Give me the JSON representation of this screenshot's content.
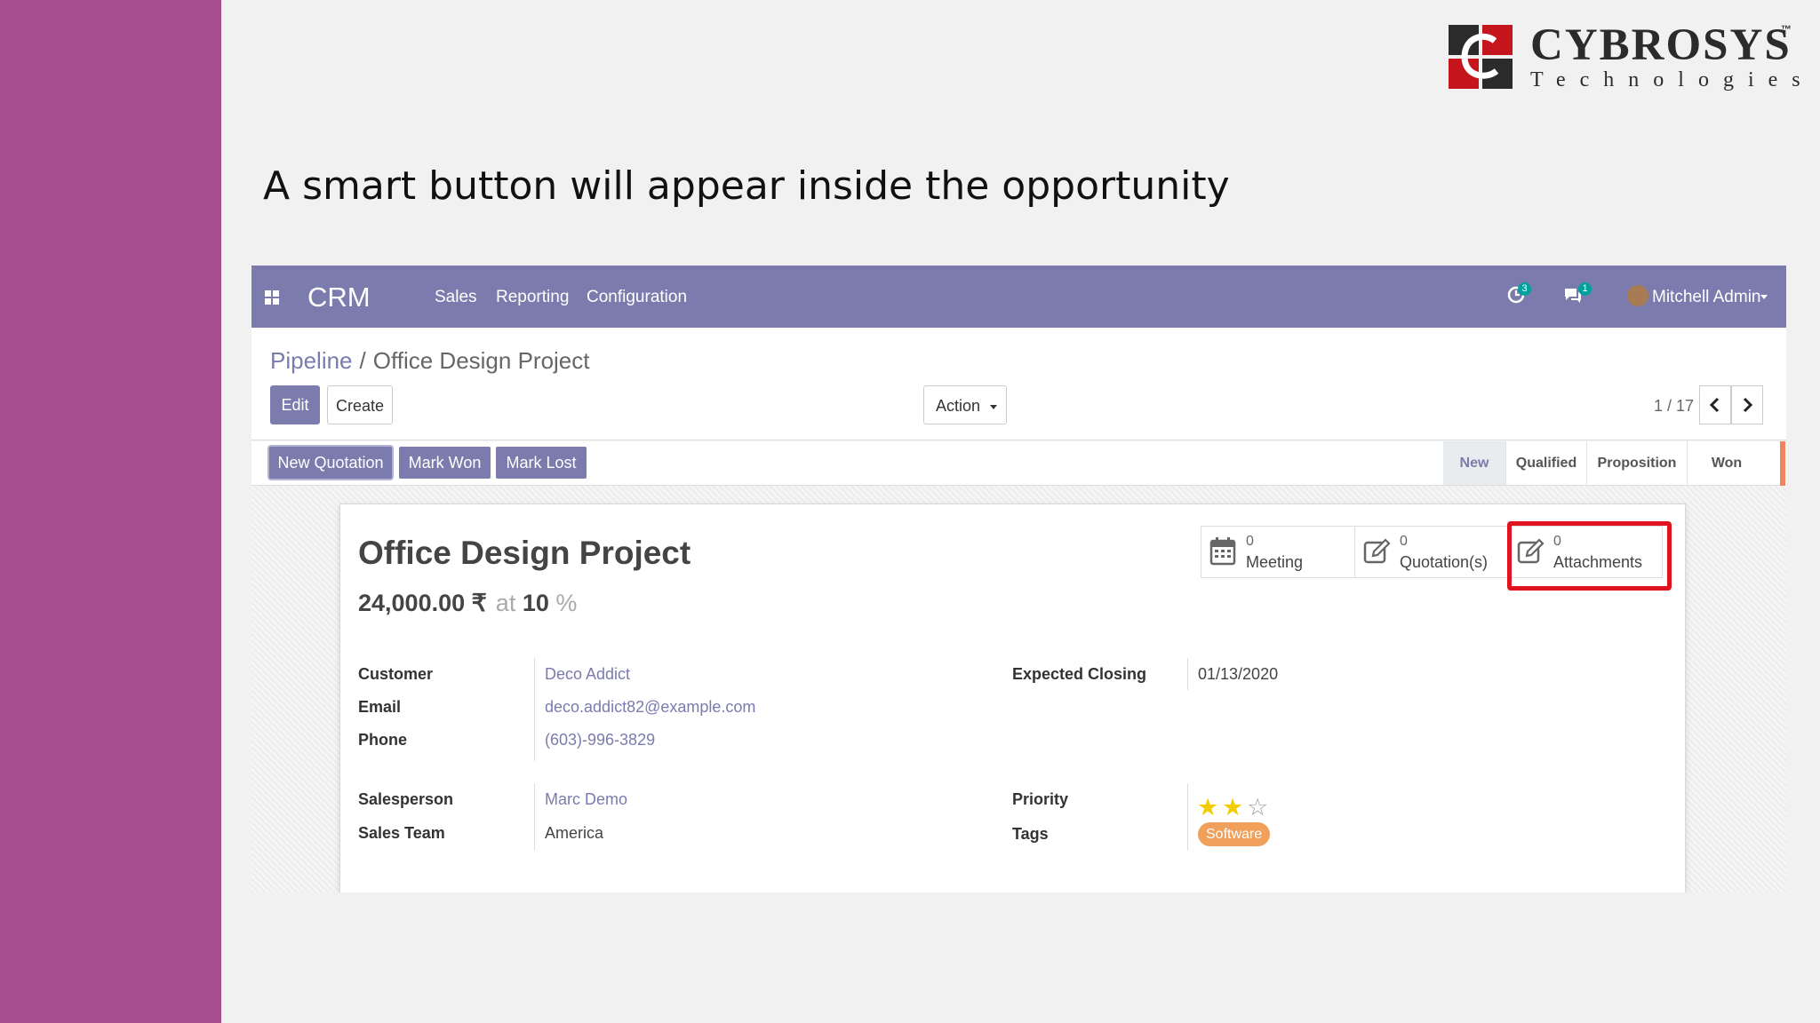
{
  "slide": {
    "title": "A smart button will appear inside the opportunity",
    "logo": {
      "name": "CYBROSYS",
      "tagline": "Technologies",
      "trademark": "™",
      "accent": "#c4161c"
    },
    "band_color": "#a64d8f"
  },
  "navbar": {
    "app_name": "CRM",
    "menu": [
      "Sales",
      "Reporting",
      "Configuration"
    ],
    "activity_badge": "3",
    "message_badge": "1",
    "user": "Mitchell Admin",
    "color": "#7c7bad"
  },
  "control_panel": {
    "breadcrumb_parent": "Pipeline",
    "breadcrumb_separator": "/",
    "breadcrumb_current": "Office Design Project",
    "edit": "Edit",
    "create": "Create",
    "action": "Action",
    "pager": "1 / 17"
  },
  "statusbar": {
    "buttons": [
      "New Quotation",
      "Mark Won",
      "Mark Lost"
    ],
    "stages": [
      "New",
      "Qualified",
      "Proposition",
      "Won"
    ],
    "active_stage": "New"
  },
  "record": {
    "title": "Office Design Project",
    "expected_revenue": "24,000.00 ₹",
    "at": "at",
    "probability": "10",
    "percent": "%",
    "smart_buttons": [
      {
        "count": "0",
        "label": "Meeting",
        "icon": "calendar-icon"
      },
      {
        "count": "0",
        "label": "Quotation(s)",
        "icon": "edit-icon"
      },
      {
        "count": "0",
        "label": "Attachments",
        "icon": "edit-icon",
        "highlighted": true
      }
    ],
    "highlight_color": "#e0141f",
    "fields_left": [
      {
        "label": "Customer",
        "value": "Deco Addict"
      },
      {
        "label": "Email",
        "value": "deco.addict82@example.com"
      },
      {
        "label": "Phone",
        "value": "(603)-996-3829"
      },
      {
        "label": "Salesperson",
        "value": "Marc Demo"
      },
      {
        "label": "Sales Team",
        "value": "America"
      }
    ],
    "fields_right": [
      {
        "label": "Expected Closing",
        "value": "01/13/2020"
      },
      {
        "label": "Priority"
      },
      {
        "label": "Tags",
        "value": "Software"
      }
    ],
    "priority_stars": 2,
    "priority_max": 3,
    "tag_color": "#f0a05a"
  }
}
